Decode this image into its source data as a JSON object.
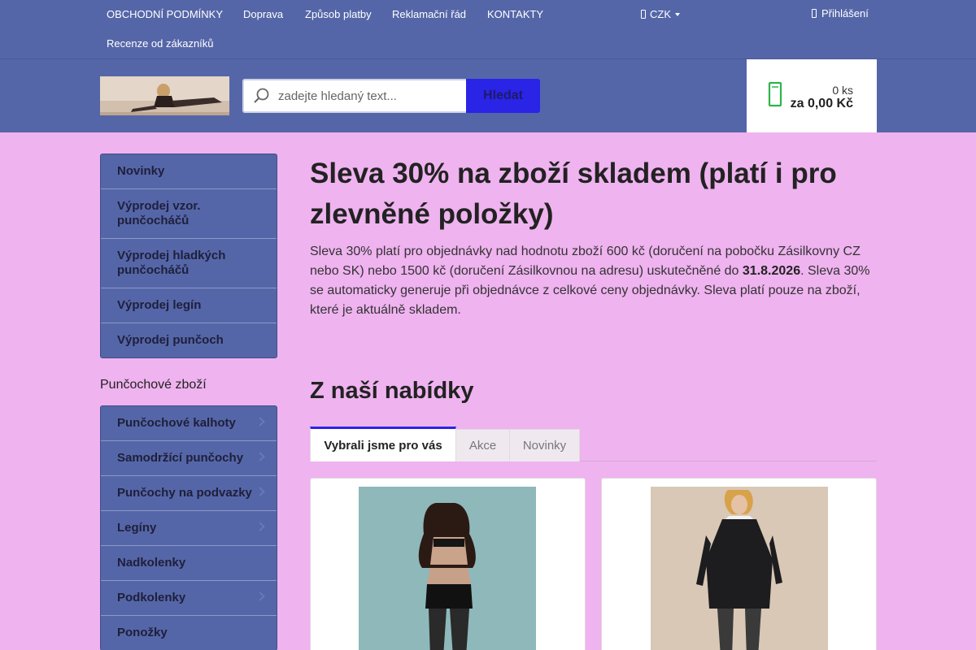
{
  "topnav": {
    "links": [
      "OBCHODNÍ PODMÍNKY",
      "Doprava",
      "Způsob platby",
      "Reklamační řád",
      "KONTAKTY",
      "Recenze od zákazníků"
    ],
    "currency": "CZK",
    "login": "Přihlášení"
  },
  "header": {
    "search_placeholder": "zadejte hledaný text...",
    "search_button": "Hledat",
    "cart_qty": "0 ks",
    "cart_price": "za 0,00 Kč"
  },
  "sidebar": {
    "menu1": [
      "Novinky",
      "Výprodej vzor. punčocháčů",
      "Výprodej hladkých punčocháčů",
      "Výprodej legín",
      "Výprodej punčoch"
    ],
    "section_title": "Punčochové zboží",
    "menu2": [
      "Punčochové kalhoty",
      "Samodržící punčochy",
      "Punčochy na podvazky",
      "Legíny",
      "Nadkolenky",
      "Podkolenky",
      "Ponožky"
    ]
  },
  "main": {
    "title": "Sleva 30% na zboží skladem (platí i pro zlevněné položky)",
    "promo_part1": "Sleva 30% platí pro objednávky nad hodnotu zboží 600 kč (doručení na pobočku Zásilkovny CZ nebo SK) nebo 1500 kč (doručení Zásilkovnou na adresu) uskutečněné do ",
    "promo_date": "31.8.2026",
    "promo_part2": ". Sleva 30% se automaticky generuje při objednávce z celkové ceny objednávky. Sleva platí pouze na zboží, které je aktuálně skladem.",
    "offers_title": "Z naší nabídky",
    "tabs": [
      "Vybrali jsme pro vás",
      "Akce",
      "Novinky"
    ]
  },
  "colors": {
    "page_bg": "#efb3ef",
    "header_bg": "#5566a8",
    "accent": "#2a24e6",
    "cart_icon": "#2fb34a"
  },
  "icons": {
    "search": "search-icon",
    "cart": "cart-icon",
    "user": "user-icon",
    "currency_caret": "caret-down-icon"
  }
}
